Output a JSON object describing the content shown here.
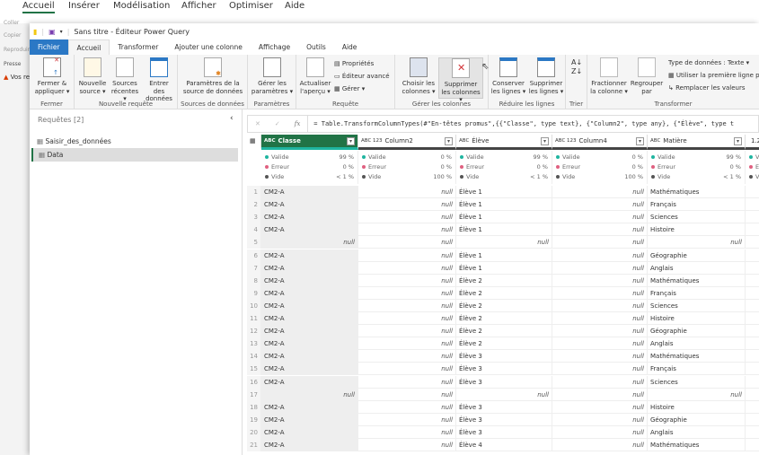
{
  "background_app": {
    "tabs": [
      "Accueil",
      "Insérer",
      "Modélisation",
      "Afficher",
      "Optimiser",
      "Aide"
    ],
    "left_items": [
      "Coller",
      "Copier",
      "Reproduire",
      "Presse",
      "Vos re"
    ]
  },
  "window": {
    "title": "Sans titre - Éditeur Power Query"
  },
  "tabs": [
    "Fichier",
    "Accueil",
    "Transformer",
    "Ajouter une colonne",
    "Affichage",
    "Outils",
    "Aide"
  ],
  "ribbon": {
    "fermer": {
      "label": "Fermer",
      "btn": "Fermer & appliquer ▾"
    },
    "nouvelle": {
      "label": "Nouvelle requête",
      "btns": [
        "Nouvelle source ▾",
        "Sources récentes ▾",
        "Entrer des données"
      ]
    },
    "sources": {
      "label": "Sources de données",
      "btn": "Paramètres de la source de données"
    },
    "params": {
      "label": "Paramètres",
      "btn": "Gérer les paramètres ▾"
    },
    "requete": {
      "label": "Requête",
      "btn": "Actualiser l'aperçu ▾",
      "small": [
        "Propriétés",
        "Éditeur avancé",
        "Gérer ▾"
      ]
    },
    "colonnes": {
      "label": "Gérer les colonnes",
      "btns": [
        "Choisir les colonnes ▾",
        "Supprimer les colonnes ▾"
      ]
    },
    "lignes": {
      "label": "Réduire les lignes",
      "btns": [
        "Conserver les lignes ▾",
        "Supprimer les lignes ▾"
      ]
    },
    "trier": {
      "label": "Trier"
    },
    "transformer": {
      "label": "Transformer",
      "btns": [
        "Fractionner la colonne ▾",
        "Regrouper par"
      ],
      "small": [
        "Type de données : Texte ▾",
        "Utiliser la première ligne p",
        "Remplacer les valeurs"
      ]
    }
  },
  "queries": {
    "title": "Requêtes [2]",
    "items": [
      "Saisir_des_données",
      "Data"
    ],
    "selected": "Data"
  },
  "formula": "= Table.TransformColumnTypes(#\"En-têtes promus\",{{\"Classe\", type text}, {\"Column2\", type any}, {\"Élève\", type t",
  "columns": [
    {
      "name": "Classe",
      "type": "ABC",
      "valide": "99 %",
      "erreur": "0 %",
      "vide": "< 1 %"
    },
    {
      "name": "Column2",
      "type": "ABC 123",
      "valide": "0 %",
      "erreur": "0 %",
      "vide": "100 %"
    },
    {
      "name": "Élève",
      "type": "ABC",
      "valide": "99 %",
      "erreur": "0 %",
      "vide": "< 1 %"
    },
    {
      "name": "Column4",
      "type": "ABC 123",
      "valide": "0 %",
      "erreur": "0 %",
      "vide": "100 %"
    },
    {
      "name": "Matière",
      "type": "ABC",
      "valide": "99 %",
      "erreur": "0 %",
      "vide": "< 1 %"
    },
    {
      "name": "1.2",
      "type": "",
      "valide": "V",
      "erreur": "E",
      "vide": "V"
    }
  ],
  "profile_labels": {
    "valide": "Valide",
    "erreur": "Erreur",
    "vide": "Vide"
  },
  "null_text": "null",
  "rows": [
    [
      "CM2-A",
      "Élève 1",
      "Mathématiques"
    ],
    [
      "CM2-A",
      "Élève 1",
      "Français"
    ],
    [
      "CM2-A",
      "Élève 1",
      "Sciences"
    ],
    [
      "CM2-A",
      "Élève 1",
      "Histoire"
    ],
    [
      null,
      null,
      null
    ],
    [
      "CM2-A",
      "Élève 1",
      "Géographie"
    ],
    [
      "CM2-A",
      "Élève 1",
      "Anglais"
    ],
    [
      "CM2-A",
      "Élève 2",
      "Mathématiques"
    ],
    [
      "CM2-A",
      "Élève 2",
      "Français"
    ],
    [
      "CM2-A",
      "Élève 2",
      "Sciences"
    ],
    [
      "CM2-A",
      "Élève 2",
      "Histoire"
    ],
    [
      "CM2-A",
      "Élève 2",
      "Géographie"
    ],
    [
      "CM2-A",
      "Élève 2",
      "Anglais"
    ],
    [
      "CM2-A",
      "Élève 3",
      "Mathématiques"
    ],
    [
      "CM2-A",
      "Élève 3",
      "Français"
    ],
    [
      "CM2-A",
      "Élève 3",
      "Sciences"
    ],
    [
      null,
      null,
      null
    ],
    [
      "CM2-A",
      "Élève 3",
      "Histoire"
    ],
    [
      "CM2-A",
      "Élève 3",
      "Géographie"
    ],
    [
      "CM2-A",
      "Élève 3",
      "Anglais"
    ],
    [
      "CM2-A",
      "Élève 4",
      "Mathématiques"
    ]
  ],
  "colors": {
    "accent": "#217346",
    "file": "#2b78c5",
    "valid": "#1fb5a0",
    "error": "#e06080",
    "empty": "#555555"
  }
}
